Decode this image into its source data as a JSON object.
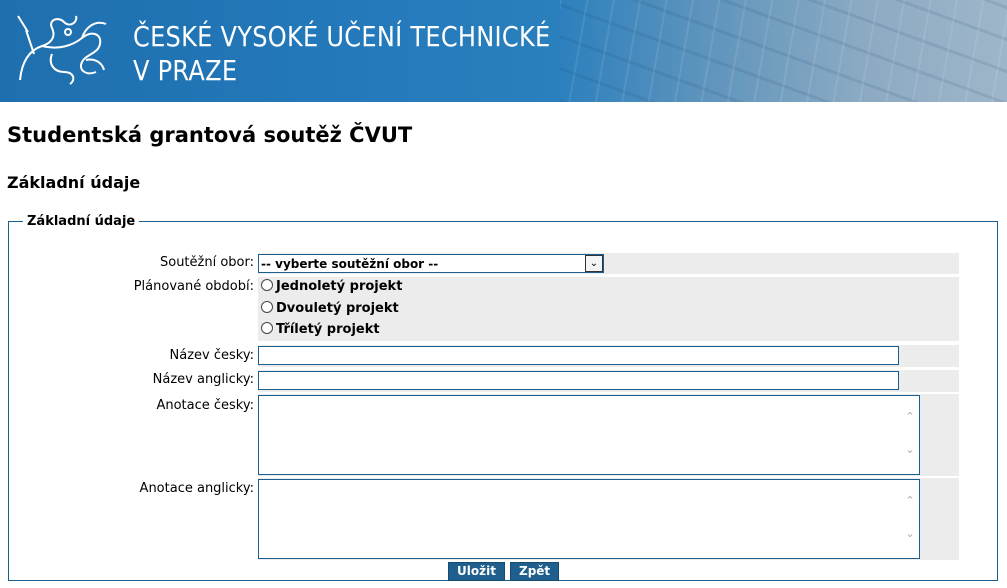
{
  "header": {
    "title_line1": "ČESKÉ VYSOKÉ UČENÍ TECHNICKÉ",
    "title_line2": "V PRAZE",
    "logo_icon": "cvut-lion-logo-icon"
  },
  "page": {
    "title": "Studentská grantová soutěž ČVUT",
    "section_title": "Základní údaje"
  },
  "form": {
    "legend": "Základní údaje",
    "field_label": "Soutěžní obor:",
    "field_value": "-- vyberte soutěžní obor --",
    "period_label": "Plánované období:",
    "period_options": [
      "Jednoletý projekt",
      "Dvouletý projekt",
      "Tříletý projekt"
    ],
    "name_cz_label": "Název česky:",
    "name_cz_value": "",
    "name_en_label": "Název anglicky:",
    "name_en_value": "",
    "annot_cz_label": "Anotace česky:",
    "annot_cz_value": "",
    "annot_en_label": "Anotace anglicky:",
    "annot_en_value": "",
    "save_label": "Uložit",
    "back_label": "Zpět"
  },
  "colors": {
    "brand_blue": "#2379ba",
    "button_blue": "#1e5f8e",
    "field_bg": "#ececec"
  }
}
